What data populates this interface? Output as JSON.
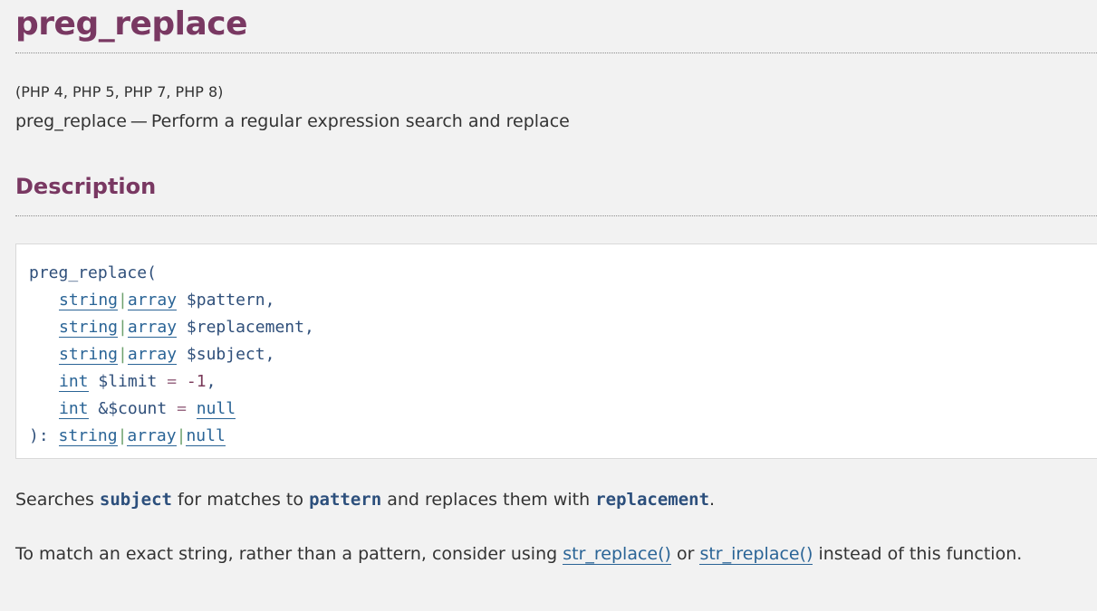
{
  "header": {
    "title": "preg_replace",
    "versions": "(PHP 4, PHP 5, PHP 7, PHP 8)",
    "refname": "preg_replace",
    "dash": "—",
    "purpose": "Perform a regular expression search and replace"
  },
  "description": {
    "heading": "Description"
  },
  "synopsis": {
    "open": "preg_replace(",
    "params": [
      {
        "types": [
          "string",
          "array"
        ],
        "name": "$pattern",
        "suffix": ","
      },
      {
        "types": [
          "string",
          "array"
        ],
        "name": "$replacement",
        "suffix": ","
      },
      {
        "types": [
          "string",
          "array"
        ],
        "name": "$subject",
        "suffix": ","
      },
      {
        "types": [
          "int"
        ],
        "name": "$limit",
        "eq": "=",
        "default": "-1",
        "suffix": ","
      },
      {
        "types": [
          "int"
        ],
        "name": "&$count",
        "eq": "=",
        "default": "null",
        "suffix": ""
      }
    ],
    "close": "):",
    "return_types": [
      "string",
      "array",
      "null"
    ],
    "type_separator": "|"
  },
  "para1": {
    "t1": "Searches",
    "p1": "subject",
    "t2": "for matches to",
    "p2": "pattern",
    "t3": "and replaces them with",
    "p3": "replacement",
    "t4": "."
  },
  "para2": {
    "t1": "To match an exact string, rather than a pattern, consider using",
    "link1": "str_replace()",
    "t2": "or",
    "link2": "str_ireplace()",
    "t3": "instead of this function."
  },
  "colors": {
    "heading": "#793862",
    "link": "#2a6496",
    "background": "#f2f2f2"
  }
}
